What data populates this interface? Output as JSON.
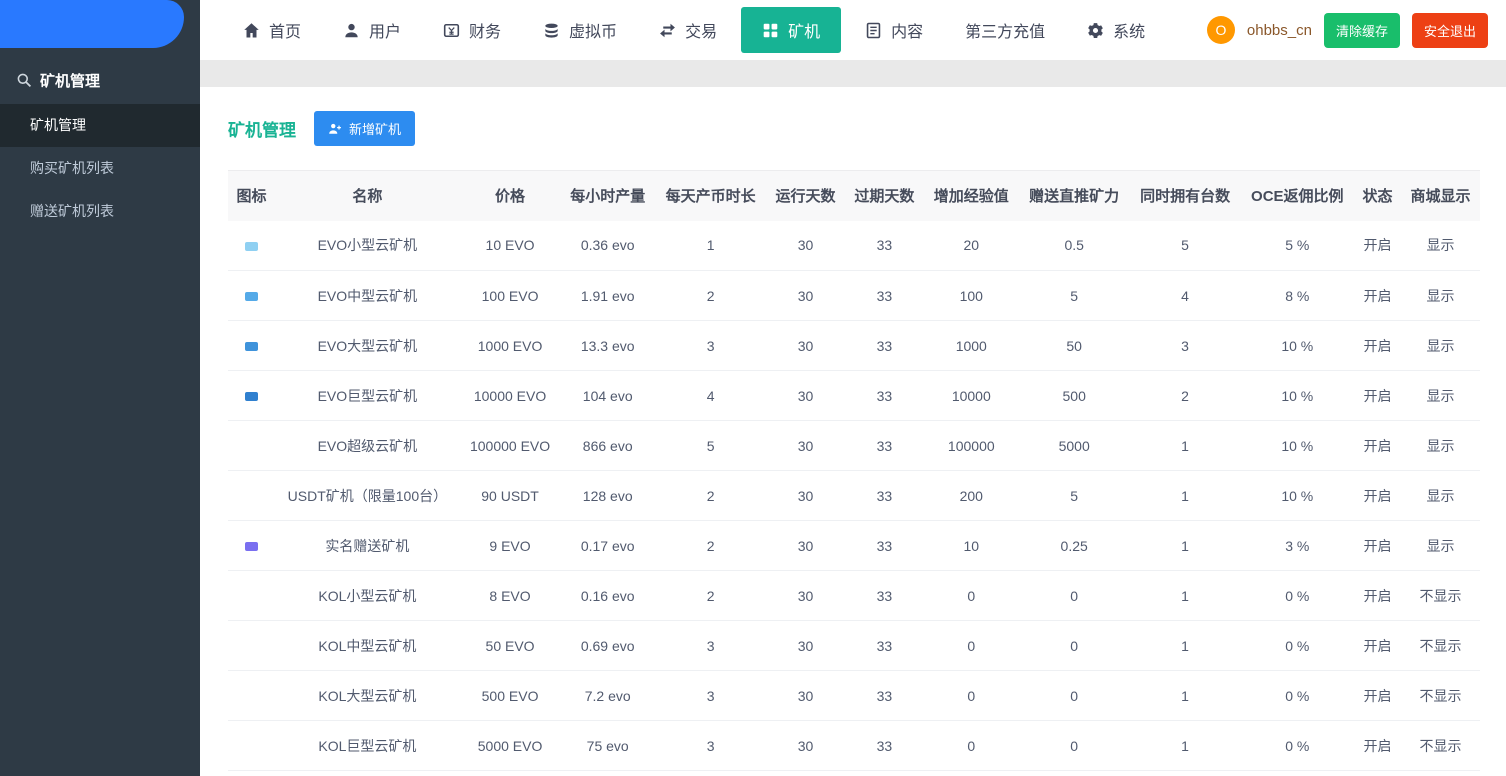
{
  "navbar": {
    "items": [
      {
        "label": "首页",
        "icon": "home-icon",
        "active": false
      },
      {
        "label": "用户",
        "icon": "user-icon",
        "active": false
      },
      {
        "label": "财务",
        "icon": "finance-icon",
        "active": false
      },
      {
        "label": "虚拟币",
        "icon": "coins-icon",
        "active": false
      },
      {
        "label": "交易",
        "icon": "exchange-icon",
        "active": false
      },
      {
        "label": "矿机",
        "icon": "miner-icon",
        "active": true
      },
      {
        "label": "内容",
        "icon": "content-icon",
        "active": false
      },
      {
        "label": "第三方充值",
        "icon": "",
        "active": false
      },
      {
        "label": "系统",
        "icon": "gear-icon",
        "active": false
      }
    ],
    "avatar_letter": "O",
    "username": "ohbbs_cn",
    "clear_cache_label": "清除缓存",
    "logout_label": "安全退出"
  },
  "sidebar": {
    "header": "矿机管理",
    "items": [
      {
        "label": "矿机管理",
        "active": true
      },
      {
        "label": "购买矿机列表",
        "active": false
      },
      {
        "label": "赠送矿机列表",
        "active": false
      }
    ]
  },
  "main": {
    "title": "矿机管理",
    "add_button": "新增矿机",
    "table": {
      "headers": [
        "图标",
        "名称",
        "价格",
        "每小时产量",
        "每天产币时长",
        "运行天数",
        "过期天数",
        "增加经验值",
        "赠送直推矿力",
        "同时拥有台数",
        "OCE返佣比例",
        "状态",
        "商城显示"
      ],
      "rows": [
        {
          "icon": true,
          "icon_color": "#8fd0f2",
          "name": "EVO小型云矿机",
          "price": "10 EVO",
          "hourly": "0.36 evo",
          "hours": "1",
          "run_days": "30",
          "expire_days": "33",
          "exp": "20",
          "gift_power": "0.5",
          "max_units": "5",
          "oce_rate": "5 %",
          "status": "开启",
          "shop": "显示"
        },
        {
          "icon": true,
          "icon_color": "#55aae8",
          "name": "EVO中型云矿机",
          "price": "100 EVO",
          "hourly": "1.91 evo",
          "hours": "2",
          "run_days": "30",
          "expire_days": "33",
          "exp": "100",
          "gift_power": "5",
          "max_units": "4",
          "oce_rate": "8 %",
          "status": "开启",
          "shop": "显示"
        },
        {
          "icon": true,
          "icon_color": "#3f93db",
          "name": "EVO大型云矿机",
          "price": "1000 EVO",
          "hourly": "13.3 evo",
          "hours": "3",
          "run_days": "30",
          "expire_days": "33",
          "exp": "1000",
          "gift_power": "50",
          "max_units": "3",
          "oce_rate": "10 %",
          "status": "开启",
          "shop": "显示"
        },
        {
          "icon": true,
          "icon_color": "#3080cf",
          "name": "EVO巨型云矿机",
          "price": "10000 EVO",
          "hourly": "104 evo",
          "hours": "4",
          "run_days": "30",
          "expire_days": "33",
          "exp": "10000",
          "gift_power": "500",
          "max_units": "2",
          "oce_rate": "10 %",
          "status": "开启",
          "shop": "显示"
        },
        {
          "icon": false,
          "icon_color": "",
          "name": "EVO超级云矿机",
          "price": "100000 EVO",
          "hourly": "866 evo",
          "hours": "5",
          "run_days": "30",
          "expire_days": "33",
          "exp": "100000",
          "gift_power": "5000",
          "max_units": "1",
          "oce_rate": "10 %",
          "status": "开启",
          "shop": "显示"
        },
        {
          "icon": false,
          "icon_color": "",
          "name": "USDT矿机（限量100台）",
          "price": "90 USDT",
          "hourly": "128 evo",
          "hours": "2",
          "run_days": "30",
          "expire_days": "33",
          "exp": "200",
          "gift_power": "5",
          "max_units": "1",
          "oce_rate": "10 %",
          "status": "开启",
          "shop": "显示"
        },
        {
          "icon": true,
          "icon_color": "#7a6ff0",
          "name": "实名赠送矿机",
          "price": "9 EVO",
          "hourly": "0.17 evo",
          "hours": "2",
          "run_days": "30",
          "expire_days": "33",
          "exp": "10",
          "gift_power": "0.25",
          "max_units": "1",
          "oce_rate": "3 %",
          "status": "开启",
          "shop": "显示"
        },
        {
          "icon": false,
          "icon_color": "",
          "name": "KOL小型云矿机",
          "price": "8 EVO",
          "hourly": "0.16 evo",
          "hours": "2",
          "run_days": "30",
          "expire_days": "33",
          "exp": "0",
          "gift_power": "0",
          "max_units": "1",
          "oce_rate": "0 %",
          "status": "开启",
          "shop": "不显示"
        },
        {
          "icon": false,
          "icon_color": "",
          "name": "KOL中型云矿机",
          "price": "50 EVO",
          "hourly": "0.69 evo",
          "hours": "3",
          "run_days": "30",
          "expire_days": "33",
          "exp": "0",
          "gift_power": "0",
          "max_units": "1",
          "oce_rate": "0 %",
          "status": "开启",
          "shop": "不显示"
        },
        {
          "icon": false,
          "icon_color": "",
          "name": "KOL大型云矿机",
          "price": "500 EVO",
          "hourly": "7.2 evo",
          "hours": "3",
          "run_days": "30",
          "expire_days": "33",
          "exp": "0",
          "gift_power": "0",
          "max_units": "1",
          "oce_rate": "0 %",
          "status": "开启",
          "shop": "不显示"
        },
        {
          "icon": false,
          "icon_color": "",
          "name": "KOL巨型云矿机",
          "price": "5000 EVO",
          "hourly": "75 evo",
          "hours": "3",
          "run_days": "30",
          "expire_days": "33",
          "exp": "0",
          "gift_power": "0",
          "max_units": "1",
          "oce_rate": "0 %",
          "status": "开启",
          "shop": "不显示"
        }
      ]
    }
  },
  "colors": {
    "accent_green": "#17b394",
    "add_button_blue": "#2d8cf0",
    "cache_green": "#19be6b",
    "logout_red": "#ed4014",
    "avatar_orange": "#ff9800",
    "logo_blue": "#2979ff",
    "sidebar_dark": "#2e3a45"
  }
}
